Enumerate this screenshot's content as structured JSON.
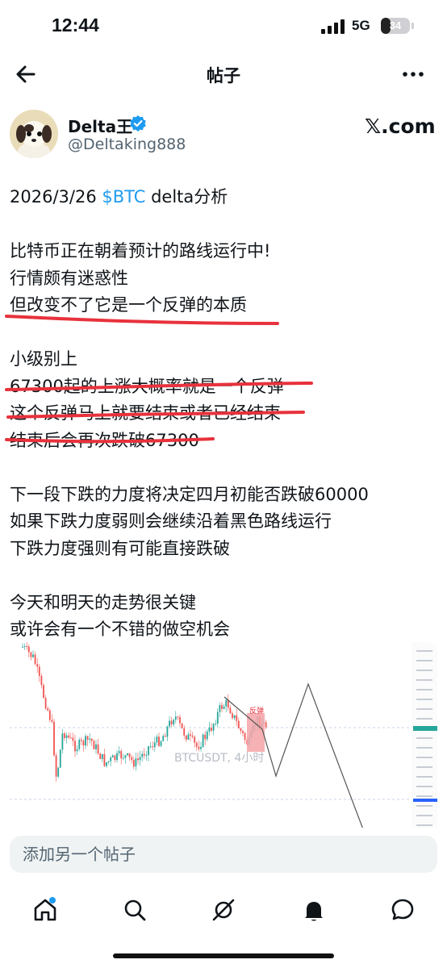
{
  "status_bar": {
    "time": "12:44",
    "network": "5G",
    "battery": "34",
    "battery_level": 0.34
  },
  "nav": {
    "title": "帖子"
  },
  "author": {
    "name": "Delta王",
    "handle": "@Deltaking888",
    "verified": true,
    "platform_logo": "𝕏.com"
  },
  "post": {
    "date": "2026/3/26",
    "cashtag": "$BTC",
    "topic": "delta分析",
    "lines": [
      "比特币正在朝着预计的路线运行中!",
      "行情颇有迷惑性",
      "但改变不了它是一个反弹的本质",
      "",
      "小级别上",
      "67300起的上涨大概率就是一个反弹",
      "这个反弹马上就要结束或者已经结束",
      "结束后会再次跌破67300",
      "",
      "下一段下跌的力度将决定四月初能否跌破60000",
      "如果下跌力度弱则会继续沿着黑色路线运行",
      "下跌力度强则有可能直接跌破",
      "",
      "今天和明天的走势很关键",
      "或许会有一个不错的做空机会"
    ],
    "underline_color": "#e8323c"
  },
  "chart": {
    "watermark": "BTCUSDT, 4小时",
    "box_label": "反弹",
    "colors": {
      "up": "#26a69a",
      "down": "#ef5350",
      "path": "#444444",
      "box": "#f4a3a8"
    }
  },
  "reply": {
    "placeholder": "添加另一个帖子"
  },
  "tabs": [
    {
      "icon": "home-icon",
      "has_dot": true
    },
    {
      "icon": "search-icon"
    },
    {
      "icon": "grok-icon"
    },
    {
      "icon": "bell-icon"
    },
    {
      "icon": "messages-icon"
    }
  ],
  "colors": {
    "accent": "#1d9bf0",
    "text": "#0f1419",
    "secondary": "#536471"
  }
}
